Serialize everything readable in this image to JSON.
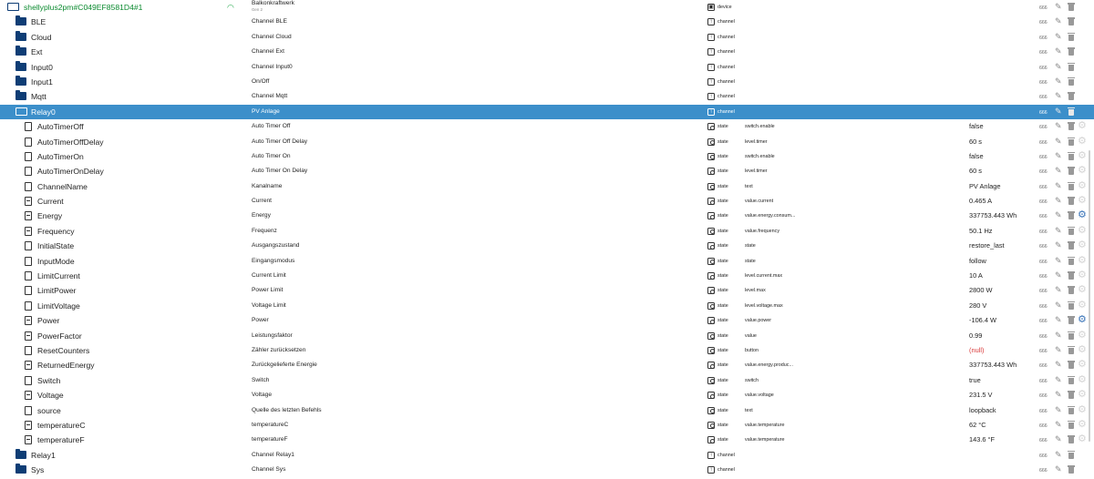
{
  "rows": [
    {
      "level": 0,
      "icon": "folder-open-icon",
      "label": "shellyplus2pm#C049EF8581D4#1",
      "name": "Balkonkraftwerk",
      "sub": "Gen 2",
      "type_icon": "device-icon",
      "type": "device",
      "role": "",
      "value": "",
      "acl": "666",
      "wifi": true
    },
    {
      "level": 1,
      "icon": "folder-icon",
      "label": "BLE",
      "name": "Channel BLE",
      "type_icon": "channel-icon",
      "type": "channel",
      "role": "",
      "value": "",
      "acl": "666"
    },
    {
      "level": 1,
      "icon": "folder-icon",
      "label": "Cloud",
      "name": "Channel Cloud",
      "type_icon": "channel-icon",
      "type": "channel",
      "role": "",
      "value": "",
      "acl": "666"
    },
    {
      "level": 1,
      "icon": "folder-icon",
      "label": "Ext",
      "name": "Channel Ext",
      "type_icon": "channel-icon",
      "type": "channel",
      "role": "",
      "value": "",
      "acl": "666"
    },
    {
      "level": 1,
      "icon": "folder-icon",
      "label": "Input0",
      "name": "Channel Input0",
      "type_icon": "channel-icon",
      "type": "channel",
      "role": "",
      "value": "",
      "acl": "666"
    },
    {
      "level": 1,
      "icon": "folder-icon",
      "label": "Input1",
      "name": "On/Off",
      "type_icon": "channel-icon",
      "type": "channel",
      "role": "",
      "value": "",
      "acl": "666"
    },
    {
      "level": 1,
      "icon": "folder-icon",
      "label": "Mqtt",
      "name": "Channel Mqtt",
      "type_icon": "channel-icon",
      "type": "channel",
      "role": "",
      "value": "",
      "acl": "666"
    },
    {
      "level": 1,
      "icon": "folder-open-icon",
      "label": "Relay0",
      "name": "PV Anlage",
      "type_icon": "channel-icon",
      "type": "channel",
      "role": "",
      "value": "",
      "acl": "666",
      "selected": true
    },
    {
      "level": 2,
      "icon": "file-icon",
      "label": "AutoTimerOff",
      "name": "Auto Timer Off",
      "type_icon": "state-icon",
      "type": "state",
      "role": "switch.enable",
      "value": "false",
      "acl": "666",
      "gear": false
    },
    {
      "level": 2,
      "icon": "file-icon",
      "label": "AutoTimerOffDelay",
      "name": "Auto Timer Off Delay",
      "type_icon": "state-icon",
      "type": "state",
      "role": "level.timer",
      "value": "60 s",
      "acl": "666",
      "gear": false
    },
    {
      "level": 2,
      "icon": "file-icon",
      "label": "AutoTimerOn",
      "name": "Auto Timer On",
      "type_icon": "state-icon",
      "type": "state",
      "role": "switch.enable",
      "value": "false",
      "acl": "666",
      "gear": false
    },
    {
      "level": 2,
      "icon": "file-icon",
      "label": "AutoTimerOnDelay",
      "name": "Auto Timer On Delay",
      "type_icon": "state-icon",
      "type": "state",
      "role": "level.timer",
      "value": "60 s",
      "acl": "666",
      "gear": false
    },
    {
      "level": 2,
      "icon": "file-icon",
      "label": "ChannelName",
      "name": "Kanalname",
      "type_icon": "state-icon",
      "type": "state",
      "role": "text",
      "value": "PV Anlage",
      "acl": "666",
      "gear": false
    },
    {
      "level": 2,
      "icon": "file-filled-icon",
      "label": "Current",
      "name": "Current",
      "type_icon": "state-icon",
      "type": "state",
      "role": "value.current",
      "value": "0.465 A",
      "acl": "666",
      "gear": false
    },
    {
      "level": 2,
      "icon": "file-filled-icon",
      "label": "Energy",
      "name": "Energy",
      "type_icon": "state-icon",
      "type": "state",
      "role": "value.energy.consum...",
      "value": "337753.443 Wh",
      "acl": "666",
      "gear": true
    },
    {
      "level": 2,
      "icon": "file-filled-icon",
      "label": "Frequency",
      "name": "Frequenz",
      "type_icon": "state-icon",
      "type": "state",
      "role": "value.frequency",
      "value": "50.1 Hz",
      "acl": "666",
      "gear": false
    },
    {
      "level": 2,
      "icon": "file-icon",
      "label": "InitialState",
      "name": "Ausgangszustand",
      "type_icon": "state-icon",
      "type": "state",
      "role": "state",
      "value": "restore_last",
      "acl": "666",
      "gear": false
    },
    {
      "level": 2,
      "icon": "file-icon",
      "label": "InputMode",
      "name": "Eingangsmodus",
      "type_icon": "state-icon",
      "type": "state",
      "role": "state",
      "value": "follow",
      "acl": "666",
      "gear": false
    },
    {
      "level": 2,
      "icon": "file-icon",
      "label": "LimitCurrent",
      "name": "Current Limit",
      "type_icon": "state-icon",
      "type": "state",
      "role": "level.current.max",
      "value": "10 A",
      "acl": "666",
      "gear": false
    },
    {
      "level": 2,
      "icon": "file-icon",
      "label": "LimitPower",
      "name": "Power Limit",
      "type_icon": "state-icon",
      "type": "state",
      "role": "level.max",
      "value": "2800 W",
      "acl": "666",
      "gear": false
    },
    {
      "level": 2,
      "icon": "file-icon",
      "label": "LimitVoltage",
      "name": "Voltage Limit",
      "type_icon": "state-icon",
      "type": "state",
      "role": "level.voltage.max",
      "value": "280 V",
      "acl": "666",
      "gear": false
    },
    {
      "level": 2,
      "icon": "file-filled-icon",
      "label": "Power",
      "name": "Power",
      "type_icon": "state-icon",
      "type": "state",
      "role": "value.power",
      "value": "-106.4 W",
      "acl": "666",
      "gear": true
    },
    {
      "level": 2,
      "icon": "file-filled-icon",
      "label": "PowerFactor",
      "name": "Leistungsfaktor",
      "type_icon": "state-icon",
      "type": "state",
      "role": "value",
      "value": "0.99",
      "acl": "666",
      "gear": false
    },
    {
      "level": 2,
      "icon": "file-icon",
      "label": "ResetCounters",
      "name": "Zähler zurücksetzen",
      "type_icon": "state-icon",
      "type": "state",
      "role": "button",
      "value": "(null)",
      "acl": "666",
      "gear": false,
      "null": true
    },
    {
      "level": 2,
      "icon": "file-filled-icon",
      "label": "ReturnedEnergy",
      "name": "Zurückgelieferte Energie",
      "type_icon": "state-icon",
      "type": "state",
      "role": "value.energy.produc...",
      "value": "337753.443 Wh",
      "acl": "666",
      "gear": false
    },
    {
      "level": 2,
      "icon": "file-icon",
      "label": "Switch",
      "name": "Switch",
      "type_icon": "state-icon",
      "type": "state",
      "role": "switch",
      "value": "true",
      "acl": "666",
      "gear": false
    },
    {
      "level": 2,
      "icon": "file-filled-icon",
      "label": "Voltage",
      "name": "Voltage",
      "type_icon": "state-icon",
      "type": "state",
      "role": "value.voltage",
      "value": "231.5 V",
      "acl": "666",
      "gear": false
    },
    {
      "level": 2,
      "icon": "file-icon",
      "label": "source",
      "name": "Quelle des letzten Befehls",
      "type_icon": "state-icon",
      "type": "state",
      "role": "text",
      "value": "loopback",
      "acl": "666",
      "gear": false
    },
    {
      "level": 2,
      "icon": "file-filled-icon",
      "label": "temperatureC",
      "name": "temperatureC",
      "type_icon": "state-icon",
      "type": "state",
      "role": "value.temperature",
      "value": "62 °C",
      "acl": "666",
      "gear": false
    },
    {
      "level": 2,
      "icon": "file-filled-icon",
      "label": "temperatureF",
      "name": "temperatureF",
      "type_icon": "state-icon",
      "type": "state",
      "role": "value.temperature",
      "value": "143.6 °F",
      "acl": "666",
      "gear": false
    },
    {
      "level": 1,
      "icon": "folder-icon",
      "label": "Relay1",
      "name": "Channel Relay1",
      "type_icon": "channel-icon",
      "type": "channel",
      "role": "",
      "value": "",
      "acl": "666"
    },
    {
      "level": 1,
      "icon": "folder-icon",
      "label": "Sys",
      "name": "Channel Sys",
      "type_icon": "channel-icon",
      "type": "channel",
      "role": "",
      "value": "",
      "acl": "666"
    }
  ],
  "colors": {
    "selected_row": "#3c8fca",
    "device_label": "#0b8a2f",
    "folder": "#0e3d75",
    "null_value": "#d93a3a",
    "gear_active": "#3a74b8"
  }
}
